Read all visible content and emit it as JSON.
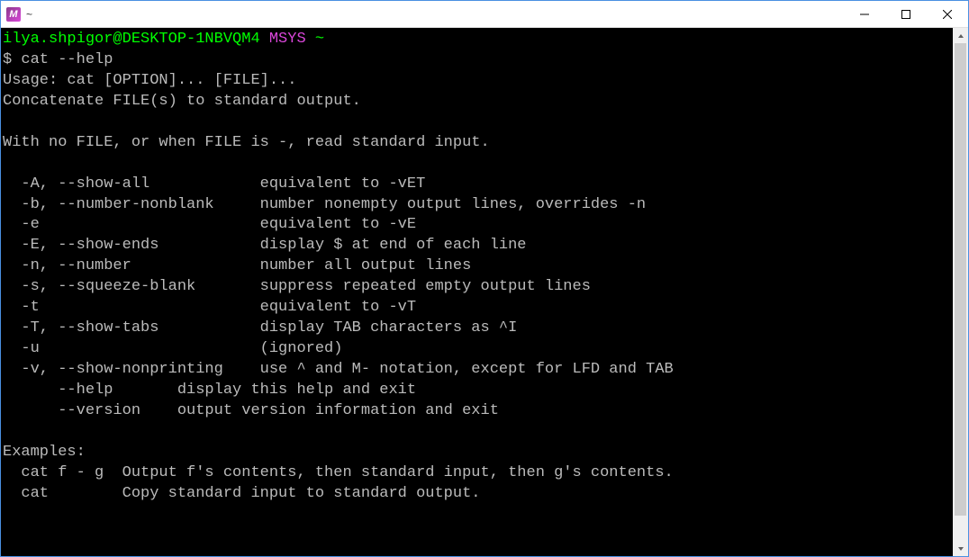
{
  "window": {
    "title": "~",
    "app_icon_letter": "M"
  },
  "prompt": {
    "user_host": "ilya.shpigor@DESKTOP-1NBVQM4",
    "env": "MSYS",
    "path": "~",
    "symbol": "$"
  },
  "command": "cat --help",
  "output": {
    "usage": "Usage: cat [OPTION]... [FILE]...",
    "description": "Concatenate FILE(s) to standard output.",
    "note": "With no FILE, or when FILE is -, read standard input.",
    "options": [
      {
        "flags": "  -A, --show-all",
        "desc": "equivalent to -vET"
      },
      {
        "flags": "  -b, --number-nonblank",
        "desc": "number nonempty output lines, overrides -n"
      },
      {
        "flags": "  -e",
        "desc": "equivalent to -vE"
      },
      {
        "flags": "  -E, --show-ends",
        "desc": "display $ at end of each line"
      },
      {
        "flags": "  -n, --number",
        "desc": "number all output lines"
      },
      {
        "flags": "  -s, --squeeze-blank",
        "desc": "suppress repeated empty output lines"
      },
      {
        "flags": "  -t",
        "desc": "equivalent to -vT"
      },
      {
        "flags": "  -T, --show-tabs",
        "desc": "display TAB characters as ^I"
      },
      {
        "flags": "  -u",
        "desc": "(ignored)"
      },
      {
        "flags": "  -v, --show-nonprinting",
        "desc": "use ^ and M- notation, except for LFD and TAB"
      }
    ],
    "extra_options": [
      {
        "flags": "      --help",
        "desc": "display this help and exit"
      },
      {
        "flags": "      --version",
        "desc": "output version information and exit"
      }
    ],
    "examples_header": "Examples:",
    "examples": [
      {
        "cmd": "  cat f - g",
        "desc": "Output f's contents, then standard input, then g's contents."
      },
      {
        "cmd": "  cat",
        "desc": "Copy standard input to standard output."
      }
    ]
  }
}
